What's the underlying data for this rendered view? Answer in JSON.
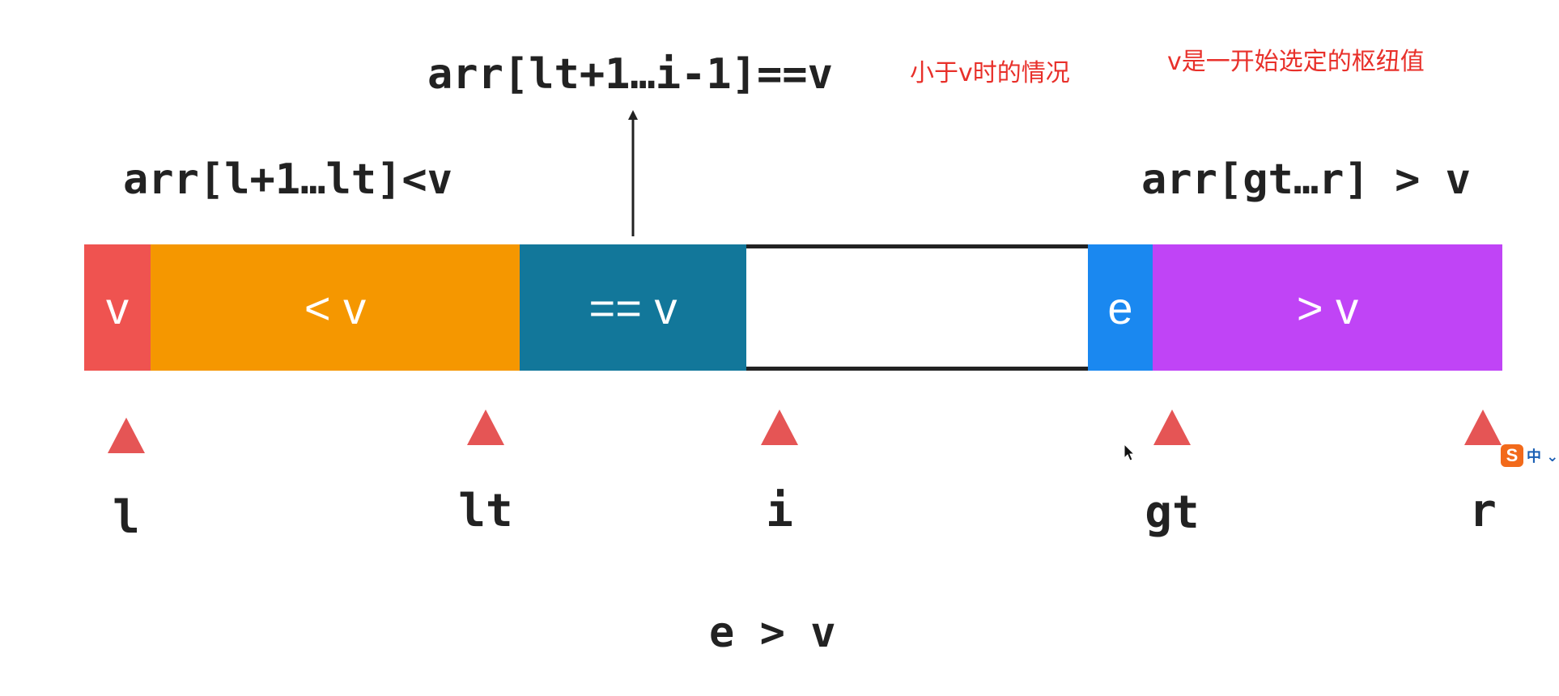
{
  "annotations": {
    "equal_range": "arr[lt+1…i-1]==v",
    "less_range": "arr[l+1…lt]<v",
    "greater_range": "arr[gt…r] > v",
    "condition": "e > v"
  },
  "notes": {
    "case_note": "小于v时的情况",
    "pivot_note": "v是一开始选定的枢纽值"
  },
  "segments": {
    "pivot": "v",
    "less": "< v",
    "equal": "== v",
    "unprocessed": "",
    "current": "e",
    "greater": "> v"
  },
  "pointers": {
    "l": "l",
    "lt": "lt",
    "i": "i",
    "gt": "gt",
    "r": "r"
  },
  "colors": {
    "pivot": "#ef5350",
    "less": "#f59700",
    "equal": "#12779a",
    "current": "#1a88f0",
    "greater": "#c044f6",
    "pointer": "#e55555",
    "note": "#e8302a"
  },
  "ime": {
    "logo": "S",
    "mode": "中 ⌄"
  }
}
